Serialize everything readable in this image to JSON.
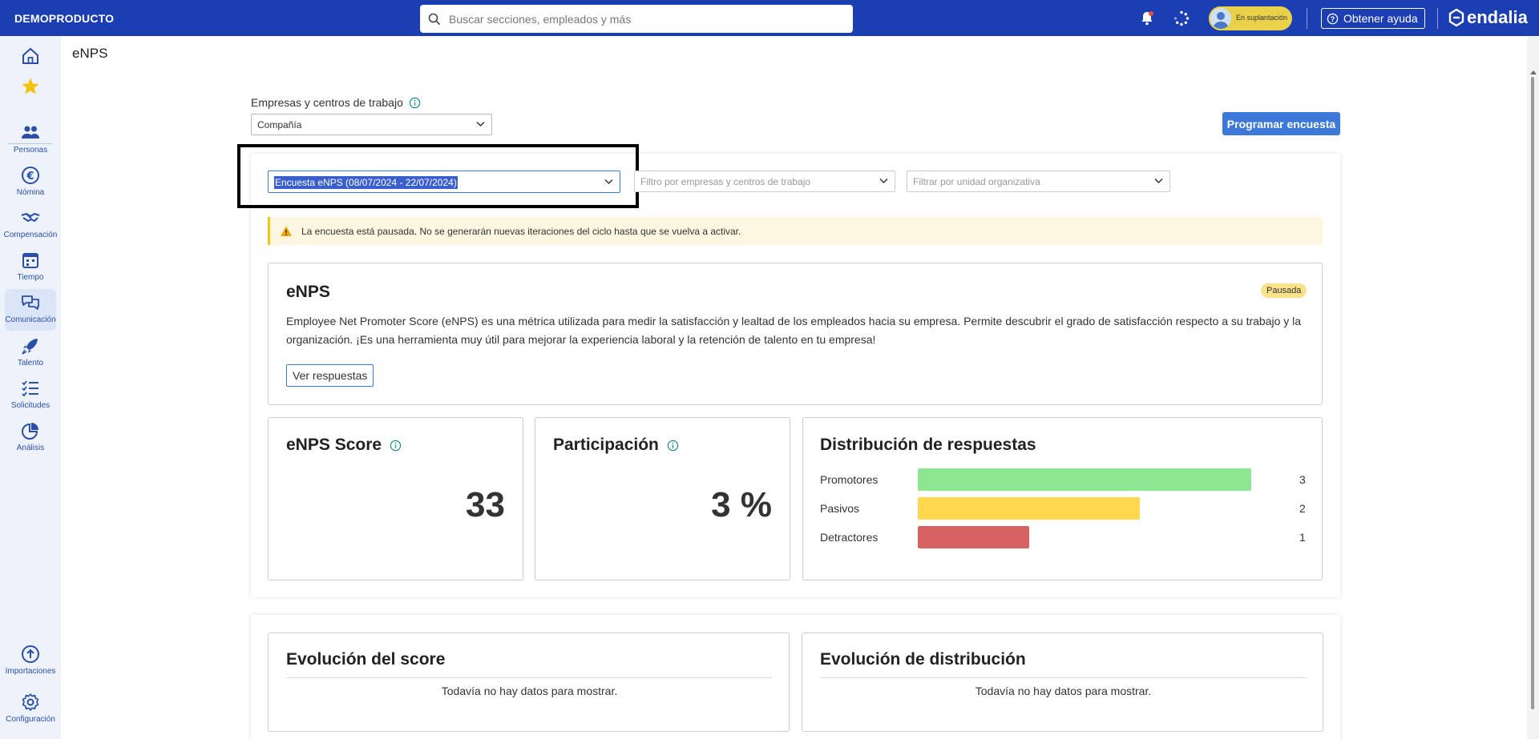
{
  "topbar": {
    "company": "DEMOPRODUCTO",
    "search_placeholder": "Buscar secciones, empleados y más",
    "impersonation_label": "En suplantación",
    "help_label": "Obtener ayuda",
    "brand": "endalia"
  },
  "sidebar": {
    "items": [
      {
        "label": "",
        "icon": "home-icon"
      },
      {
        "label": "",
        "icon": "star-icon"
      },
      {
        "label": "Personas",
        "icon": "people-icon"
      },
      {
        "label": "Nómina",
        "icon": "euro-icon"
      },
      {
        "label": "Compensación",
        "icon": "handshake-icon"
      },
      {
        "label": "Tiempo",
        "icon": "calendar-icon"
      },
      {
        "label": "Comunicación",
        "icon": "chat-icon"
      },
      {
        "label": "Talento",
        "icon": "rocket-icon"
      },
      {
        "label": "Solicitudes",
        "icon": "checklist-icon"
      },
      {
        "label": "Análisis",
        "icon": "pie-chart-icon"
      },
      {
        "label": "Importaciones",
        "icon": "upload-icon"
      },
      {
        "label": "Configuración",
        "icon": "gear-icon"
      }
    ],
    "active": "Comunicación"
  },
  "page": {
    "title": "eNPS",
    "companies_label": "Empresas y centros de trabajo",
    "company_select_value": "Compañía",
    "schedule_button": "Programar encuesta",
    "survey_select_value": "Encuesta eNPS (08/07/2024 - 22/07/2024)",
    "filter_companies_placeholder": "Filtro por empresas y centros de trabajo",
    "filter_unit_placeholder": "Filtrar por unidad organizativa",
    "alert_text": "La encuesta está pausada. No se generarán nuevas iteraciones del ciclo hasta que se vuelva a activar."
  },
  "enps_card": {
    "title": "eNPS",
    "status_badge": "Pausada",
    "description": "Employee Net Promoter Score (eNPS) es una métrica utilizada para medir la satisfacción y lealtad de los empleados hacia su empresa. Permite descubrir el grado de satisfacción respecto a su trabajo y la organización. ¡Es una herramienta muy útil para mejorar la experiencia laboral y la retención de talento en tu empresa!",
    "view_answers_button": "Ver respuestas"
  },
  "score_card": {
    "title": "eNPS Score",
    "value": "33"
  },
  "participation_card": {
    "title": "Participación",
    "value": "3 %"
  },
  "distribution_card": {
    "title": "Distribución de respuestas",
    "rows": [
      {
        "label": "Promotores",
        "count": 3,
        "color": "#8ee693"
      },
      {
        "label": "Pasivos",
        "count": 2,
        "color": "#ffd84d"
      },
      {
        "label": "Detractores",
        "count": 1,
        "color": "#d66363"
      }
    ],
    "max_count": 3
  },
  "evolution_score_card": {
    "title": "Evolución del score",
    "empty": "Todavía no hay datos para mostrar."
  },
  "evolution_distribution_card": {
    "title": "Evolución de distribución",
    "empty": "Todavía no hay datos para mostrar."
  },
  "colors": {
    "primary": "#1c3eb3",
    "accent": "#3b78d8",
    "sidebar": "#edf2fb"
  }
}
